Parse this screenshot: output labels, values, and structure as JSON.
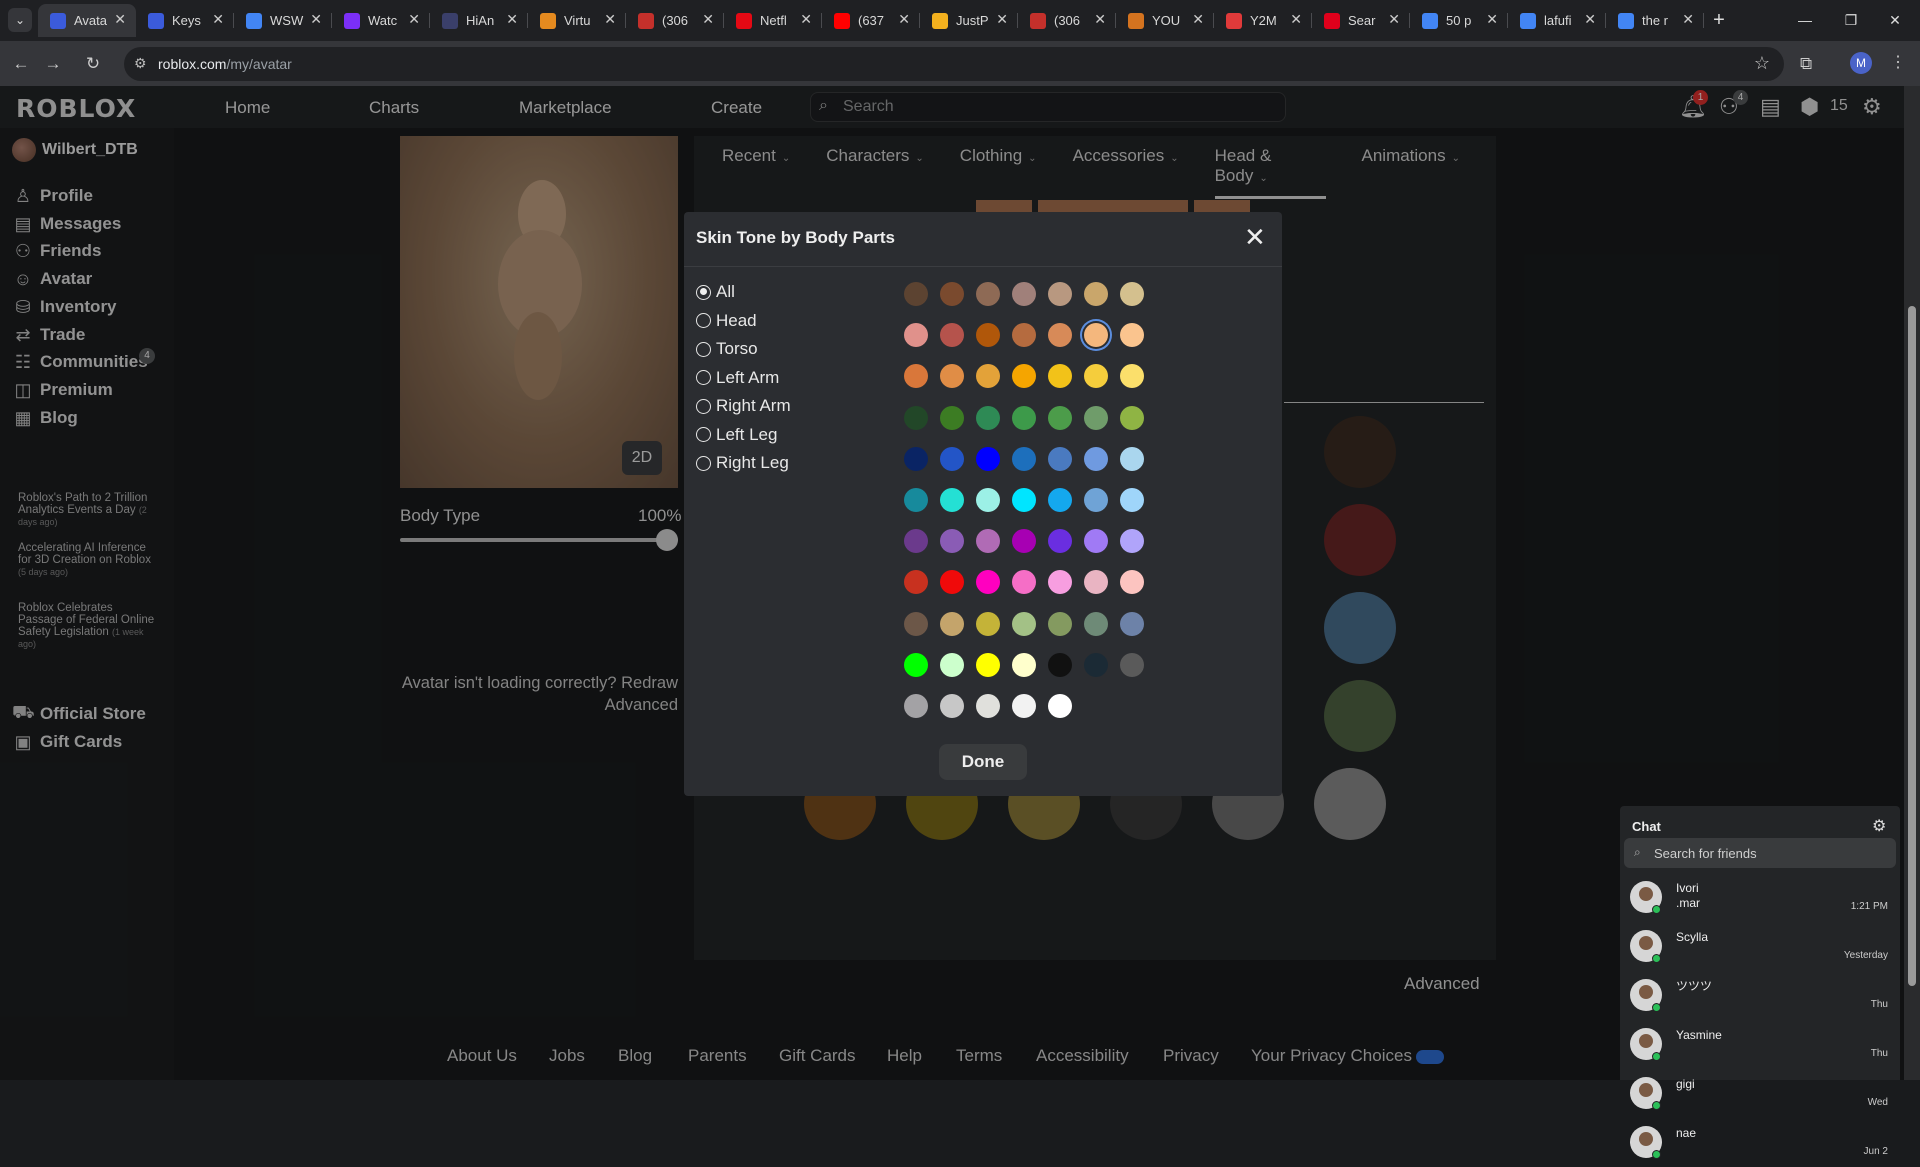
{
  "browser": {
    "tabs": [
      {
        "label": "Avata",
        "color": "#3b5bdb",
        "active": true
      },
      {
        "label": "Keys",
        "color": "#3b5bdb"
      },
      {
        "label": "WSW",
        "color": "#4285f4"
      },
      {
        "label": "Watc",
        "color": "#7b2ff7"
      },
      {
        "label": "HiAn",
        "color": "#3a3f6a"
      },
      {
        "label": "Virtu",
        "color": "#e58a1f"
      },
      {
        "label": "(306",
        "color": "#c4302b"
      },
      {
        "label": "Netfl",
        "color": "#e50914"
      },
      {
        "label": "(637",
        "color": "#ff0000"
      },
      {
        "label": "JustP",
        "color": "#f2b01e"
      },
      {
        "label": "(306",
        "color": "#c4302b"
      },
      {
        "label": "YOU",
        "color": "#d4731f"
      },
      {
        "label": "Y2M",
        "color": "#e03a3a"
      },
      {
        "label": "Sear",
        "color": "#e0001b"
      },
      {
        "label": "50 p",
        "color": "#4285f4"
      },
      {
        "label": "lafufi",
        "color": "#4285f4"
      },
      {
        "label": "the r",
        "color": "#4285f4"
      }
    ],
    "new_tab": "+",
    "url_host": "roblox.com",
    "url_path": "/my/avatar",
    "profile_initial": "M"
  },
  "topnav": {
    "logo": "ROBLOX",
    "links": [
      "Home",
      "Charts",
      "Marketplace",
      "Create"
    ],
    "search_placeholder": "Search",
    "notif_count": "1",
    "friend_req_count": "4",
    "robux": "15"
  },
  "sidebar": {
    "username": "Wilbert_DTB",
    "items": [
      {
        "label": "Profile",
        "icon": "person-icon"
      },
      {
        "label": "Messages",
        "icon": "messages-icon"
      },
      {
        "label": "Friends",
        "icon": "friends-icon"
      },
      {
        "label": "Avatar",
        "icon": "avatar-icon"
      },
      {
        "label": "Inventory",
        "icon": "inventory-icon"
      },
      {
        "label": "Trade",
        "icon": "trade-icon"
      },
      {
        "label": "Communities",
        "icon": "communities-icon"
      },
      {
        "label": "Premium",
        "icon": "premium-icon"
      },
      {
        "label": "Blog",
        "icon": "blog-icon"
      }
    ],
    "friends_count": "4",
    "blog_posts": [
      {
        "title": "Roblox's Path to 2 Trillion Analytics Events a Day",
        "ago": "(2 days ago)"
      },
      {
        "title": "Accelerating AI Inference for 3D Creation on Roblox",
        "ago": "(5 days ago)"
      },
      {
        "title": "Roblox Celebrates Passage of Federal Online Safety Legislation",
        "ago": "(1 week ago)"
      }
    ],
    "bottom_items": [
      {
        "label": "Official Store",
        "icon": "store-icon"
      },
      {
        "label": "Gift Cards",
        "icon": "gift-card-icon"
      }
    ]
  },
  "avatar_panel": {
    "button_2d": "2D",
    "body_type_label": "Body Type",
    "body_type_value": "100%",
    "body_type_fraction": 1.0,
    "loading_msg": "Avatar isn't loading correctly?",
    "redraw": "Redraw",
    "advanced": "Advanced"
  },
  "editor": {
    "categories": [
      "Recent",
      "Characters",
      "Clothing",
      "Accessories",
      "Head & Body",
      "Animations"
    ],
    "active_category": "Head & Body",
    "advanced": "Advanced",
    "background_swatches": [
      "#3b2c22",
      "#6a2727",
      "#4a7090",
      "#506444",
      "#7a4e1e",
      "#7c6a1a",
      "#8a7a3a",
      "#39393a",
      "#6f6f6f",
      "#8c8c8c"
    ]
  },
  "modal": {
    "title": "Skin Tone by Body Parts",
    "parts": [
      "All",
      "Head",
      "Torso",
      "Left Arm",
      "Right Arm",
      "Left Leg",
      "Right Leg"
    ],
    "selected_part": "All",
    "selected_color": "#f4b77d",
    "done": "Done",
    "palette": [
      [
        "#5c4331",
        "#7a4a2e",
        "#8e6a55",
        "#a0807a",
        "#b89880",
        "#c9a66b",
        "#d4c08e"
      ],
      [
        "#e0918b",
        "#b5534c",
        "#b0570a",
        "#b56b3f",
        "#d78a58",
        "#f4b77d",
        "#fac48e"
      ],
      [
        "#d9773a",
        "#e08d46",
        "#e3a239",
        "#f5a500",
        "#f2c219",
        "#f5cd3c",
        "#fbdf6b"
      ],
      [
        "#224728",
        "#3c7c23",
        "#2e8a55",
        "#3d9a4a",
        "#4c9c4a",
        "#6f9c6a",
        "#8fb444"
      ],
      [
        "#0a2464",
        "#2355c7",
        "#0000ff",
        "#1d6fbc",
        "#4a7ac0",
        "#6f9ae0",
        "#aad6ee"
      ],
      [
        "#178a9c",
        "#24e0d4",
        "#9cf0e6",
        "#00e5ff",
        "#14a8ee",
        "#6fa3d6",
        "#9fd5fa"
      ],
      [
        "#6b3a8c",
        "#8a5cb5",
        "#b06bb5",
        "#a700b3",
        "#6a2ee0",
        "#a07af5",
        "#b0a4fa"
      ],
      [
        "#c8311f",
        "#f00a0a",
        "#ff00bf",
        "#f56ec6",
        "#f79ee0",
        "#e9b4c2",
        "#fcc4c0"
      ],
      [
        "#6c5748",
        "#c4a46b",
        "#c4b338",
        "#a3c186",
        "#849a60",
        "#6e8a77",
        "#6d82a8"
      ],
      [
        "#00ff00",
        "#ccffcc",
        "#ffff00",
        "#ffffcc",
        "#111111",
        "#1b2a35",
        "#5a5a5a"
      ],
      [
        "#a3a2a5",
        "#c7c7c7",
        "#e0e0dc",
        "#f2f2f2",
        "#ffffff"
      ]
    ]
  },
  "footer": {
    "links": [
      "About Us",
      "Jobs",
      "Blog",
      "Parents",
      "Gift Cards",
      "Help",
      "Terms",
      "Accessibility",
      "Privacy",
      "Your Privacy Choices"
    ]
  },
  "chat": {
    "title": "Chat",
    "search_placeholder": "Search for friends",
    "conversations": [
      {
        "name": "Ivori\n.mar",
        "time": "1:21 PM"
      },
      {
        "name": "Scylla",
        "time": "Yesterday"
      },
      {
        "name": "ツツツ",
        "time": "Thu"
      },
      {
        "name": "Yasmine",
        "time": "Thu"
      },
      {
        "name": "gigi",
        "time": "Wed"
      },
      {
        "name": "nae",
        "time": "Jun 2"
      }
    ]
  }
}
